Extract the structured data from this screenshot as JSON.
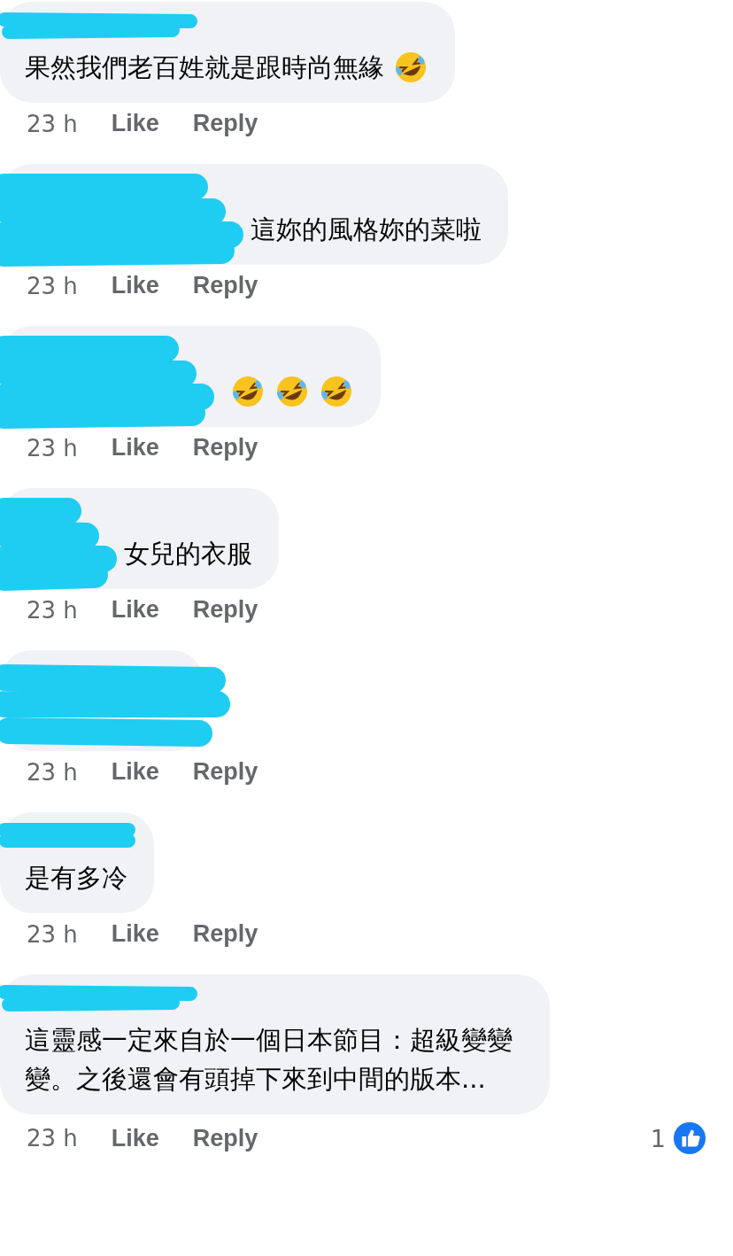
{
  "comments": [
    {
      "text": "果然我們老百姓就是跟時尚無緣",
      "emojis": [
        {
          "kind": "laughing"
        }
      ],
      "time": "23 h",
      "like": "Like",
      "reply": "Reply"
    },
    {
      "text": "這妳的風格妳的菜啦",
      "time": "23 h",
      "like": "Like",
      "reply": "Reply"
    },
    {
      "emojis": [
        {
          "kind": "laughing"
        },
        {
          "kind": "laughing"
        },
        {
          "kind": "laughing"
        }
      ],
      "time": "23 h",
      "like": "Like",
      "reply": "Reply"
    },
    {
      "text": "女兒的衣服",
      "time": "23 h",
      "like": "Like",
      "reply": "Reply"
    },
    {
      "time": "23 h",
      "like": "Like",
      "reply": "Reply"
    },
    {
      "text": "是有多冷",
      "time": "23 h",
      "like": "Like",
      "reply": "Reply"
    },
    {
      "text": "這靈感一定來自於一個日本節目：超級變變變。之後還會有頭掉下來到中間的版本...",
      "time": "23 h",
      "like": "Like",
      "reply": "Reply",
      "like_count": "1"
    }
  ]
}
